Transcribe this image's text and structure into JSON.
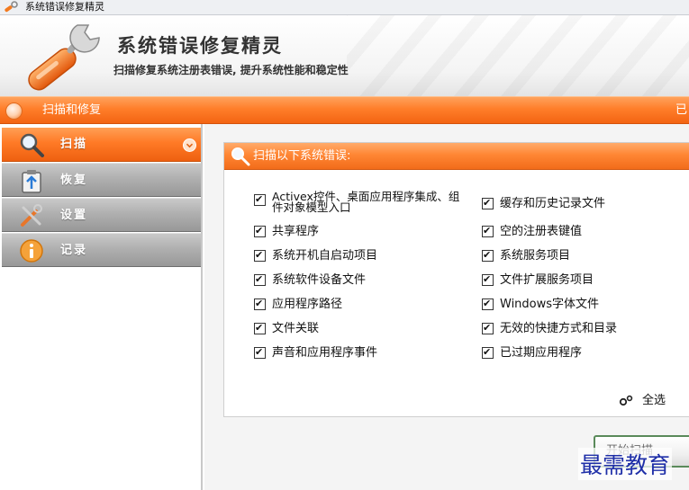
{
  "window": {
    "title": "系统错误修复精灵"
  },
  "header": {
    "title": "系统错误修复精灵",
    "subtitle": "扫描修复系统注册表错误, 提升系统性能和稳定性"
  },
  "navbar": {
    "label": "扫描和修复",
    "right_text": "已"
  },
  "sidebar": {
    "items": [
      {
        "label": "扫描",
        "icon": "magnifier-icon",
        "active": true
      },
      {
        "label": "恢复",
        "icon": "restore-clipboard-icon",
        "active": false
      },
      {
        "label": "设置",
        "icon": "tools-icon",
        "active": false
      },
      {
        "label": "记录",
        "icon": "info-icon",
        "active": false
      }
    ]
  },
  "panel": {
    "title": "扫描以下系统错误:",
    "left_options": [
      {
        "label": "Activex控件、桌面应用程序集成、组件对象模型入口",
        "checked": true
      },
      {
        "label": "共享程序",
        "checked": true
      },
      {
        "label": "系统开机自启动项目",
        "checked": true
      },
      {
        "label": "系统软件设备文件",
        "checked": true
      },
      {
        "label": "应用程序路径",
        "checked": true
      },
      {
        "label": "文件关联",
        "checked": true
      },
      {
        "label": "声音和应用程序事件",
        "checked": true
      }
    ],
    "right_options": [
      {
        "label": "缓存和历史记录文件",
        "checked": true
      },
      {
        "label": "空的注册表键值",
        "checked": true
      },
      {
        "label": "系统服务项目",
        "checked": true
      },
      {
        "label": "文件扩展服务项目",
        "checked": true
      },
      {
        "label": "Windows字体文件",
        "checked": true
      },
      {
        "label": "无效的快捷方式和目录",
        "checked": true
      },
      {
        "label": "已过期应用程序",
        "checked": true
      }
    ],
    "select_all": "全选"
  },
  "scan_button": {
    "label": "开始扫描"
  },
  "watermark": "最需教育",
  "colors": {
    "accent": "#ff7a26",
    "sidebar_inactive": "#b0b0b0",
    "watermark": "#1f2fa8"
  }
}
